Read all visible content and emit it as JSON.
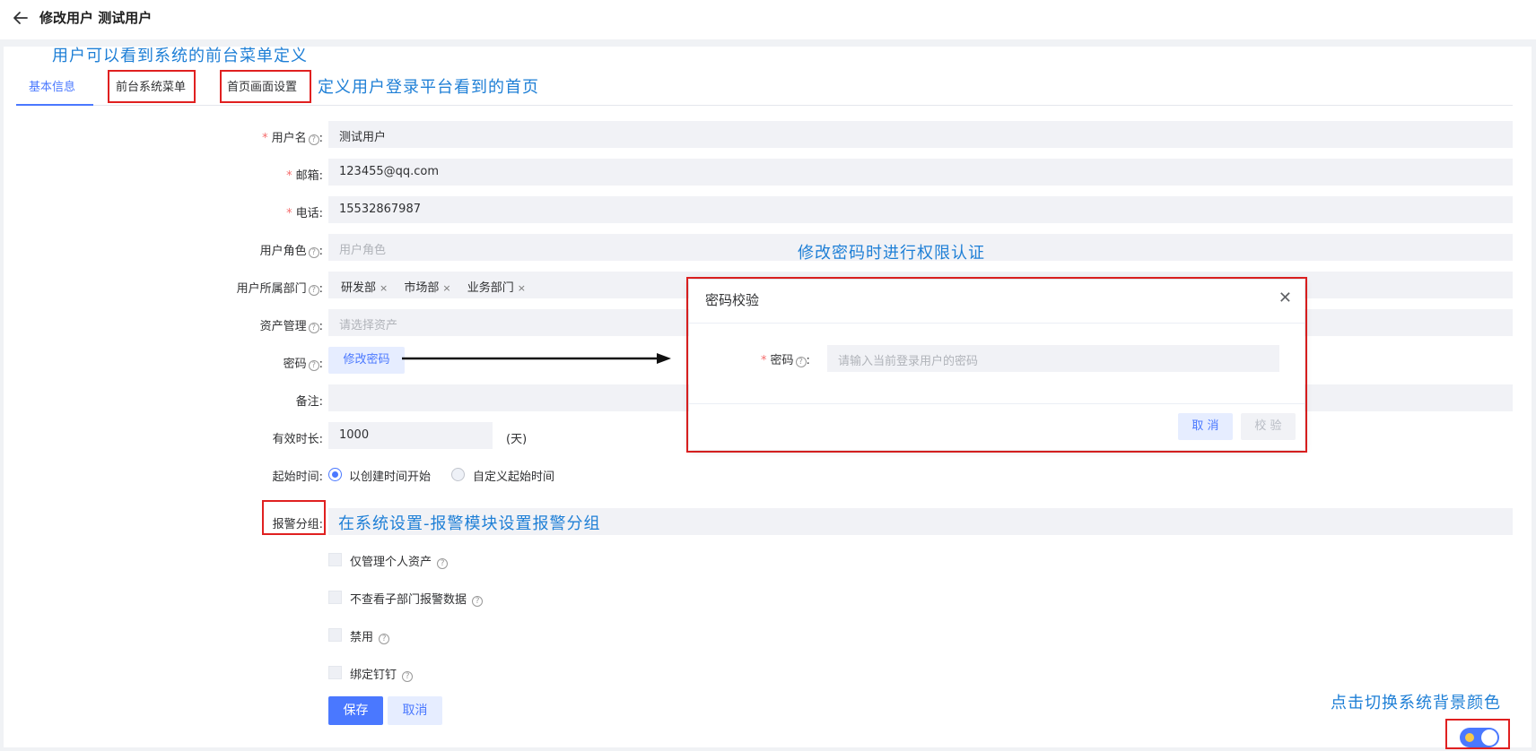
{
  "header": {
    "title": "修改用户 测试用户",
    "back_icon": "arrow-left-icon"
  },
  "tabs": [
    {
      "label": "基本信息",
      "active": true
    },
    {
      "label": "前台系统菜单",
      "active": false
    },
    {
      "label": "首页画面设置",
      "active": false
    }
  ],
  "form": {
    "username": {
      "label": "用户名",
      "value": "测试用户"
    },
    "email": {
      "label": "邮箱",
      "value": "123455@qq.com"
    },
    "phone": {
      "label": "电话",
      "value": "15532867987"
    },
    "role": {
      "label": "用户角色",
      "placeholder": "用户角色"
    },
    "department": {
      "label": "用户所属部门",
      "tags": [
        "研发部",
        "市场部",
        "业务部门"
      ]
    },
    "assets": {
      "label": "资产管理",
      "placeholder": "请选择资产"
    },
    "password": {
      "label": "密码",
      "button": "修改密码"
    },
    "remark": {
      "label": "备注",
      "value": ""
    },
    "duration": {
      "label": "有效时长",
      "value": "1000",
      "unit": "(天)"
    },
    "start_time": {
      "label": "起始时间",
      "options": [
        "以创建时间开始",
        "自定义起始时间"
      ],
      "selected": 0
    },
    "alarm_group": {
      "label": "报警分组"
    },
    "checkboxes": [
      "仅管理个人资产",
      "不查看子部门报警数据",
      "禁用",
      "绑定钉钉"
    ],
    "save_label": "保存",
    "cancel_label": "取消",
    "colon": ":"
  },
  "modal": {
    "title": "密码校验",
    "field_label": "密码",
    "field_placeholder": "请输入当前登录用户的密码",
    "cancel_label": "取 消",
    "verify_label": "校 验",
    "close_glyph": "✕"
  },
  "annotations": {
    "menu_note": "用户可以看到系统的前台菜单定义",
    "home_note": "定义用户登录平台看到的首页",
    "password_note": "修改密码时进行权限认证",
    "alarm_note": "在系统设置-报警模块设置报警分组",
    "theme_note": "点击切换系统背景颜色"
  },
  "colors": {
    "accent": "#4a78ff",
    "annotation": "#1e7fd6",
    "highlight_box": "#e02020",
    "required": "#f56c6c"
  },
  "theme_toggle": {
    "on": true,
    "icon": "sun-icon"
  }
}
